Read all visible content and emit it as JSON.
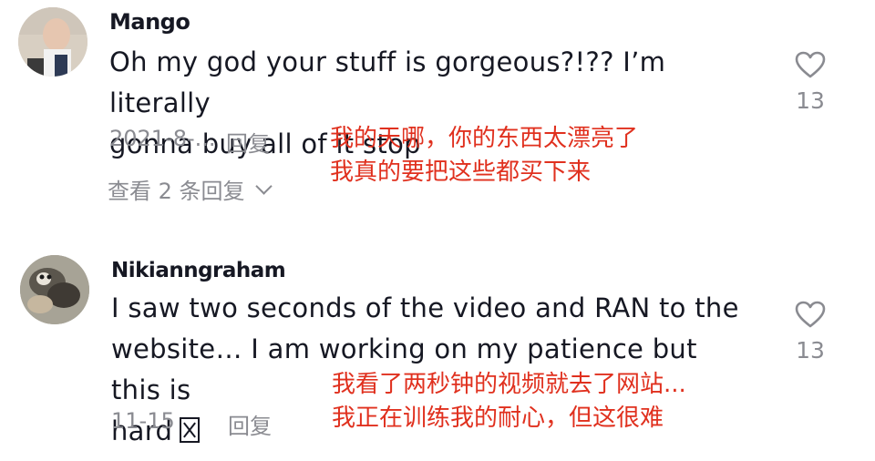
{
  "comments": [
    {
      "username": "Mango",
      "text_line1": "Oh my god your stuff is gorgeous?!?? I’m literally",
      "text_line2": "gonna buy all of it stop",
      "date": "2021-8-...",
      "reply_label": "回复",
      "view_replies_label": "查看 2 条回复",
      "like_count": "13",
      "translation_line1": "我的天哪，你的东西太漂亮了",
      "translation_line2": "我真的要把这些都买下来"
    },
    {
      "username": "Nikianngraham",
      "text_line1": "I saw two seconds of the video and RAN to the",
      "text_line2": "website… I am working on my patience but this is",
      "text_line3": "hard",
      "date": "11-15",
      "reply_label": "回复",
      "like_count": "13",
      "translation_line1": "我看了两秒钟的视频就去了网站...",
      "translation_line2": "我正在训练我的耐心，但这很难"
    }
  ],
  "colors": {
    "primary_text": "#161823",
    "secondary_text": "#8a8b91",
    "translation": "#e0301e"
  },
  "icons": {
    "like": "heart-outline-icon",
    "expand": "chevron-down-icon"
  }
}
